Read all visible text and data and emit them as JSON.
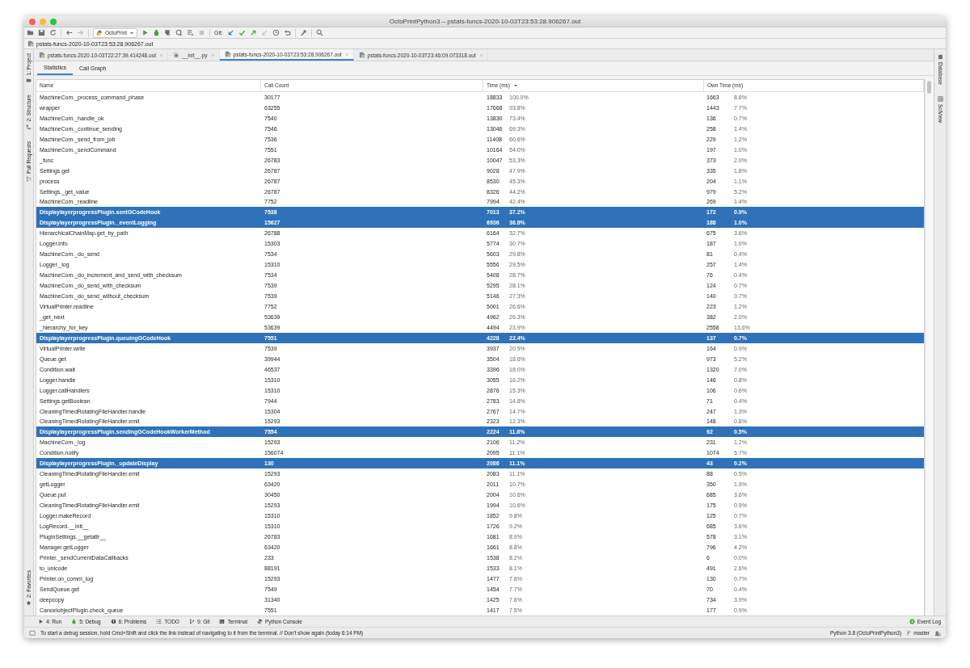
{
  "window": {
    "title": "OctoPrintPython3 – pstats-funcs-2020-10-03T23:53:28.906267.out"
  },
  "toolbar": {
    "run_config": "OctoPrint",
    "git_label": "Git:"
  },
  "breadcrumb": "pstats-funcs-2020-10-03T23:53:28.906267.out",
  "editor_tabs": [
    {
      "label": "pstats-funcs-2020-10-03T22:27:39.414248.out",
      "kind": "profile",
      "selected": false
    },
    {
      "label": "__init__.py",
      "kind": "python",
      "selected": false
    },
    {
      "label": "pstats-funcs-2020-10-03T23:53:28.906267.out",
      "kind": "profile",
      "selected": true
    },
    {
      "label": "pstats-funcs-2020-10-03T23:46:09.073318.out",
      "kind": "profile",
      "selected": false
    }
  ],
  "left_tool_windows": [
    {
      "label": "1: Project",
      "kind": "folder"
    },
    {
      "label": "2: Structure",
      "kind": "structure"
    },
    {
      "label": "Pull Requests",
      "kind": "pull"
    },
    {
      "label": "2: Favorites",
      "kind": "star"
    }
  ],
  "right_tool_windows": [
    {
      "label": "Database"
    },
    {
      "label": "SciView"
    }
  ],
  "view_tabs": [
    {
      "label": "Statistics",
      "selected": true
    },
    {
      "label": "Call Graph",
      "selected": false
    }
  ],
  "table": {
    "columns": [
      {
        "label": "Name",
        "sorted": false
      },
      {
        "label": "Call Count",
        "sorted": false
      },
      {
        "label": "Time (ms)",
        "sorted": true
      },
      {
        "label": "Own Time (ms)",
        "sorted": false
      }
    ],
    "rows": [
      {
        "name": "MachineCom._process_command_phase",
        "call_count": "30177",
        "time": "18833",
        "time_pct": "100.0%",
        "own_time": "1663",
        "own_pct": "8.8%",
        "selected": false
      },
      {
        "name": "wrapper",
        "call_count": "63255",
        "time": "17668",
        "time_pct": "93.8%",
        "own_time": "1443",
        "own_pct": "7.7%",
        "selected": false
      },
      {
        "name": "MachineCom._handle_ok",
        "call_count": "7540",
        "time": "13830",
        "time_pct": "73.4%",
        "own_time": "136",
        "own_pct": "0.7%",
        "selected": false
      },
      {
        "name": "MachineCom._continue_sending",
        "call_count": "7546",
        "time": "13046",
        "time_pct": "69.3%",
        "own_time": "258",
        "own_pct": "1.4%",
        "selected": false
      },
      {
        "name": "MachineCom._send_from_job",
        "call_count": "7536",
        "time": "11408",
        "time_pct": "60.6%",
        "own_time": "229",
        "own_pct": "1.2%",
        "selected": false
      },
      {
        "name": "MachineCom._sendCommand",
        "call_count": "7551",
        "time": "10164",
        "time_pct": "54.0%",
        "own_time": "197",
        "own_pct": "1.0%",
        "selected": false
      },
      {
        "name": "_func",
        "call_count": "26783",
        "time": "10047",
        "time_pct": "53.3%",
        "own_time": "373",
        "own_pct": "2.0%",
        "selected": false
      },
      {
        "name": "Settings.get",
        "call_count": "26787",
        "time": "9028",
        "time_pct": "47.9%",
        "own_time": "335",
        "own_pct": "1.8%",
        "selected": false
      },
      {
        "name": "process",
        "call_count": "26787",
        "time": "8530",
        "time_pct": "45.3%",
        "own_time": "204",
        "own_pct": "1.1%",
        "selected": false
      },
      {
        "name": "Settings._get_value",
        "call_count": "26787",
        "time": "8326",
        "time_pct": "44.2%",
        "own_time": "979",
        "own_pct": "5.2%",
        "selected": false
      },
      {
        "name": "MachineCom._readline",
        "call_count": "7752",
        "time": "7994",
        "time_pct": "42.4%",
        "own_time": "269",
        "own_pct": "1.4%",
        "selected": false
      },
      {
        "name": "DisplaylayerprogressPlugin.sentGCodeHook",
        "call_count": "7538",
        "time": "7013",
        "time_pct": "37.2%",
        "own_time": "172",
        "own_pct": "0.9%",
        "selected": true
      },
      {
        "name": "DisplaylayerprogressPlugin._eventLogging",
        "call_count": "15627",
        "time": "6936",
        "time_pct": "36.8%",
        "own_time": "188",
        "own_pct": "1.0%",
        "selected": true
      },
      {
        "name": "HierarchicalChainMap.get_by_path",
        "call_count": "26788",
        "time": "6164",
        "time_pct": "32.7%",
        "own_time": "675",
        "own_pct": "3.6%",
        "selected": false
      },
      {
        "name": "Logger.info",
        "call_count": "15303",
        "time": "5774",
        "time_pct": "30.7%",
        "own_time": "187",
        "own_pct": "1.0%",
        "selected": false
      },
      {
        "name": "MachineCom._do_send",
        "call_count": "7534",
        "time": "5603",
        "time_pct": "29.8%",
        "own_time": "81",
        "own_pct": "0.4%",
        "selected": false
      },
      {
        "name": "Logger._log",
        "call_count": "15310",
        "time": "5556",
        "time_pct": "29.5%",
        "own_time": "257",
        "own_pct": "1.4%",
        "selected": false
      },
      {
        "name": "MachineCom._do_increment_and_send_with_checksum",
        "call_count": "7534",
        "time": "5408",
        "time_pct": "28.7%",
        "own_time": "76",
        "own_pct": "0.4%",
        "selected": false
      },
      {
        "name": "MachineCom._do_send_with_checksum",
        "call_count": "7539",
        "time": "5295",
        "time_pct": "28.1%",
        "own_time": "124",
        "own_pct": "0.7%",
        "selected": false
      },
      {
        "name": "MachineCom._do_send_without_checksum",
        "call_count": "7539",
        "time": "5146",
        "time_pct": "27.3%",
        "own_time": "140",
        "own_pct": "0.7%",
        "selected": false
      },
      {
        "name": "VirtualPrinter.readline",
        "call_count": "7752",
        "time": "5001",
        "time_pct": "26.6%",
        "own_time": "223",
        "own_pct": "1.2%",
        "selected": false
      },
      {
        "name": "_get_next",
        "call_count": "53639",
        "time": "4962",
        "time_pct": "26.3%",
        "own_time": "382",
        "own_pct": "2.0%",
        "selected": false
      },
      {
        "name": "_hierarchy_for_key",
        "call_count": "53639",
        "time": "4494",
        "time_pct": "23.9%",
        "own_time": "2558",
        "own_pct": "13.6%",
        "selected": false
      },
      {
        "name": "DisplaylayerprogressPlugin.queuingGCodeHook",
        "call_count": "7551",
        "time": "4228",
        "time_pct": "22.4%",
        "own_time": "137",
        "own_pct": "0.7%",
        "selected": true
      },
      {
        "name": "VirtualPrinter.write",
        "call_count": "7539",
        "time": "3937",
        "time_pct": "20.9%",
        "own_time": "164",
        "own_pct": "0.9%",
        "selected": false
      },
      {
        "name": "Queue.get",
        "call_count": "39944",
        "time": "3504",
        "time_pct": "18.6%",
        "own_time": "973",
        "own_pct": "5.2%",
        "selected": false
      },
      {
        "name": "Condition.wait",
        "call_count": "46537",
        "time": "3396",
        "time_pct": "18.0%",
        "own_time": "1320",
        "own_pct": "7.0%",
        "selected": false
      },
      {
        "name": "Logger.handle",
        "call_count": "15310",
        "time": "3055",
        "time_pct": "16.2%",
        "own_time": "146",
        "own_pct": "0.8%",
        "selected": false
      },
      {
        "name": "Logger.callHandlers",
        "call_count": "15310",
        "time": "2876",
        "time_pct": "15.3%",
        "own_time": "106",
        "own_pct": "0.6%",
        "selected": false
      },
      {
        "name": "Settings.getBoolean",
        "call_count": "7944",
        "time": "2783",
        "time_pct": "14.8%",
        "own_time": "71",
        "own_pct": "0.4%",
        "selected": false
      },
      {
        "name": "CleaningTimedRotatingFileHandler.handle",
        "call_count": "15304",
        "time": "2767",
        "time_pct": "14.7%",
        "own_time": "247",
        "own_pct": "1.3%",
        "selected": false
      },
      {
        "name": "CleaningTimedRotatingFileHandler.emit",
        "call_count": "15293",
        "time": "2323",
        "time_pct": "12.3%",
        "own_time": "148",
        "own_pct": "0.8%",
        "selected": false
      },
      {
        "name": "DisplaylayerprogressPlugin.sendingGCodeHookWorkerMethod",
        "call_count": "7554",
        "time": "2224",
        "time_pct": "11.8%",
        "own_time": "92",
        "own_pct": "0.5%",
        "selected": true
      },
      {
        "name": "MachineCom._log",
        "call_count": "15293",
        "time": "2106",
        "time_pct": "11.2%",
        "own_time": "231",
        "own_pct": "1.2%",
        "selected": false
      },
      {
        "name": "Condition.notify",
        "call_count": "156074",
        "time": "2095",
        "time_pct": "11.1%",
        "own_time": "1074",
        "own_pct": "5.7%",
        "selected": false
      },
      {
        "name": "DisplaylayerprogressPlugin._updateDisplay",
        "call_count": "130",
        "time": "2086",
        "time_pct": "11.1%",
        "own_time": "43",
        "own_pct": "0.2%",
        "selected": true
      },
      {
        "name": "CleaningTimedRotatingFileHandler.emit",
        "call_count": "15293",
        "time": "2083",
        "time_pct": "11.1%",
        "own_time": "88",
        "own_pct": "0.5%",
        "selected": false
      },
      {
        "name": "getLogger",
        "call_count": "63420",
        "time": "2011",
        "time_pct": "10.7%",
        "own_time": "350",
        "own_pct": "1.9%",
        "selected": false
      },
      {
        "name": "Queue.put",
        "call_count": "30450",
        "time": "2004",
        "time_pct": "10.6%",
        "own_time": "685",
        "own_pct": "3.6%",
        "selected": false
      },
      {
        "name": "CleaningTimedRotatingFileHandler.emit",
        "call_count": "15293",
        "time": "1994",
        "time_pct": "10.6%",
        "own_time": "175",
        "own_pct": "0.9%",
        "selected": false
      },
      {
        "name": "Logger.makeRecord",
        "call_count": "15310",
        "time": "1852",
        "time_pct": "9.8%",
        "own_time": "125",
        "own_pct": "0.7%",
        "selected": false
      },
      {
        "name": "LogRecord.__init__",
        "call_count": "15310",
        "time": "1726",
        "time_pct": "9.2%",
        "own_time": "685",
        "own_pct": "3.6%",
        "selected": false
      },
      {
        "name": "PluginSettings.__getattr__",
        "call_count": "26783",
        "time": "1681",
        "time_pct": "8.9%",
        "own_time": "578",
        "own_pct": "3.1%",
        "selected": false
      },
      {
        "name": "Manager.getLogger",
        "call_count": "63420",
        "time": "1661",
        "time_pct": "8.8%",
        "own_time": "796",
        "own_pct": "4.2%",
        "selected": false
      },
      {
        "name": "Printer._sendCurrentDataCallbacks",
        "call_count": "233",
        "time": "1538",
        "time_pct": "8.2%",
        "own_time": "6",
        "own_pct": "0.0%",
        "selected": false
      },
      {
        "name": "to_unicode",
        "call_count": "88191",
        "time": "1533",
        "time_pct": "8.1%",
        "own_time": "491",
        "own_pct": "2.6%",
        "selected": false
      },
      {
        "name": "Printer.on_comm_log",
        "call_count": "15293",
        "time": "1477",
        "time_pct": "7.8%",
        "own_time": "130",
        "own_pct": "0.7%",
        "selected": false
      },
      {
        "name": "SendQueue.get",
        "call_count": "7549",
        "time": "1454",
        "time_pct": "7.7%",
        "own_time": "70",
        "own_pct": "0.4%",
        "selected": false
      },
      {
        "name": "deepcopy",
        "call_count": "31340",
        "time": "1425",
        "time_pct": "7.6%",
        "own_time": "734",
        "own_pct": "3.9%",
        "selected": false
      },
      {
        "name": "CancelobjectPlugin.check_queue",
        "call_count": "7551",
        "time": "1417",
        "time_pct": "7.5%",
        "own_time": "177",
        "own_pct": "0.9%",
        "selected": false
      }
    ]
  },
  "bottom_tool_windows": [
    {
      "label": "4: Run",
      "kind": "run"
    },
    {
      "label": "5: Debug",
      "kind": "debug"
    },
    {
      "label": "6: Problems",
      "kind": "problems"
    },
    {
      "label": "TODO",
      "kind": "todo"
    },
    {
      "label": "9: Git",
      "kind": "git"
    },
    {
      "label": "Terminal",
      "kind": "terminal"
    },
    {
      "label": "Python Console",
      "kind": "console"
    }
  ],
  "event_log": "Event Log",
  "status_bar": {
    "message": "To start a debug session, hold Cmd+Shift and click the link instead of navigating to it from the terminal. // Don't show again (today 6:14 PM)",
    "interpreter": "Python 3.8 (OctoPrintPython3)",
    "branch": "master"
  }
}
